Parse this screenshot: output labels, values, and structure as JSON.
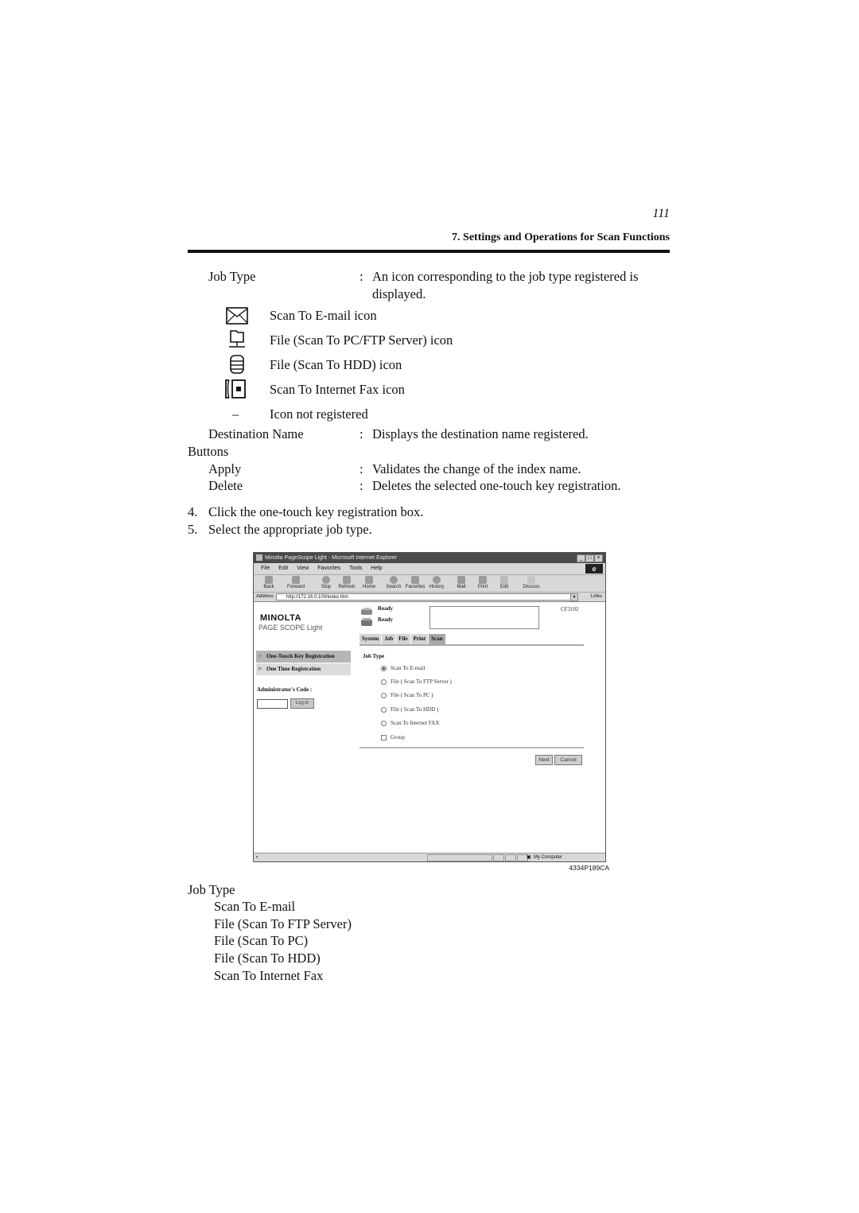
{
  "header": {
    "page_number": "111",
    "running_head": "7. Settings and Operations for Scan Functions"
  },
  "definitions": {
    "job_type": {
      "term": "Job Type",
      "colon": ":",
      "desc_line1": "An icon corresponding to the job type registered is",
      "desc_line2": "displayed."
    },
    "icon_list": [
      {
        "icon": "envelope-icon",
        "label": "Scan To E-mail icon"
      },
      {
        "icon": "network-folder-icon",
        "label": "File (Scan To PC/FTP Server) icon"
      },
      {
        "icon": "hdd-database-icon",
        "label": "File (Scan To HDD) icon"
      },
      {
        "icon": "internet-fax-icon",
        "label": "Scan To Internet Fax icon"
      },
      {
        "icon": "dash",
        "symbol": "–",
        "label": "Icon not registered"
      }
    ],
    "destination_name": {
      "term": "Destination Name",
      "colon": ":",
      "desc": "Displays the destination name registered."
    },
    "buttons_heading": "Buttons",
    "apply": {
      "term": "Apply",
      "colon": ":",
      "desc": "Validates the change of the index name."
    },
    "delete": {
      "term": "Delete",
      "colon": ":",
      "desc": "Deletes the selected one-touch key registration."
    }
  },
  "steps": [
    {
      "num": "4.",
      "text": "Click the one-touch key registration box."
    },
    {
      "num": "5.",
      "text": "Select the appropriate job type."
    }
  ],
  "browser": {
    "window_title": "Minolta PageScope Light - Microsoft Internet Explorer",
    "window_buttons": [
      "_",
      "□",
      "×"
    ],
    "menu": [
      "File",
      "Edit",
      "View",
      "Favorites",
      "Tools",
      "Help"
    ],
    "toolbar": [
      "Back",
      "Forward",
      "Stop",
      "Refresh",
      "Home",
      "Search",
      "Favorites",
      "History",
      "Mail",
      "Print",
      "Edit",
      "Discuss"
    ],
    "address_label": "Address",
    "address_value": "http://172.16.0.100/index.htm",
    "links_label": "Links",
    "logo": "MINOLTA",
    "logo_sub": "PAGE SCOPE Light",
    "status_1": "Ready",
    "status_2": "Ready",
    "model": "CF3102",
    "tabs": [
      "System",
      "Job",
      "File",
      "Print",
      "Scan"
    ],
    "active_tab": "Scan",
    "sidenav": [
      "One-Touch Key Registration",
      "One Time Registration"
    ],
    "admin_code_label": "Administrator's Code :",
    "admin_code_value": "",
    "login_label": "Log-in",
    "job_type_heading": "Job Type",
    "job_options": [
      {
        "label": "Scan To E-mail",
        "selected": true
      },
      {
        "label": "File ( Scan To FTP Server )",
        "selected": false
      },
      {
        "label": "File ( Scan To PC )",
        "selected": false
      },
      {
        "label": "File ( Scan To HDD )",
        "selected": false
      },
      {
        "label": "Scan To Internet FAX",
        "selected": false
      }
    ],
    "group_label": "Group",
    "group_checked": false,
    "next_label": "Next",
    "cancel_label": "Cancel",
    "statusbar_zone": "My Computer"
  },
  "figure_caption": "4334P189CA",
  "job_type_list": {
    "heading": "Job Type",
    "items": [
      "Scan To E-mail",
      "File (Scan To FTP Server)",
      "File (Scan To PC)",
      "File (Scan To HDD)",
      "Scan To Internet Fax"
    ]
  }
}
